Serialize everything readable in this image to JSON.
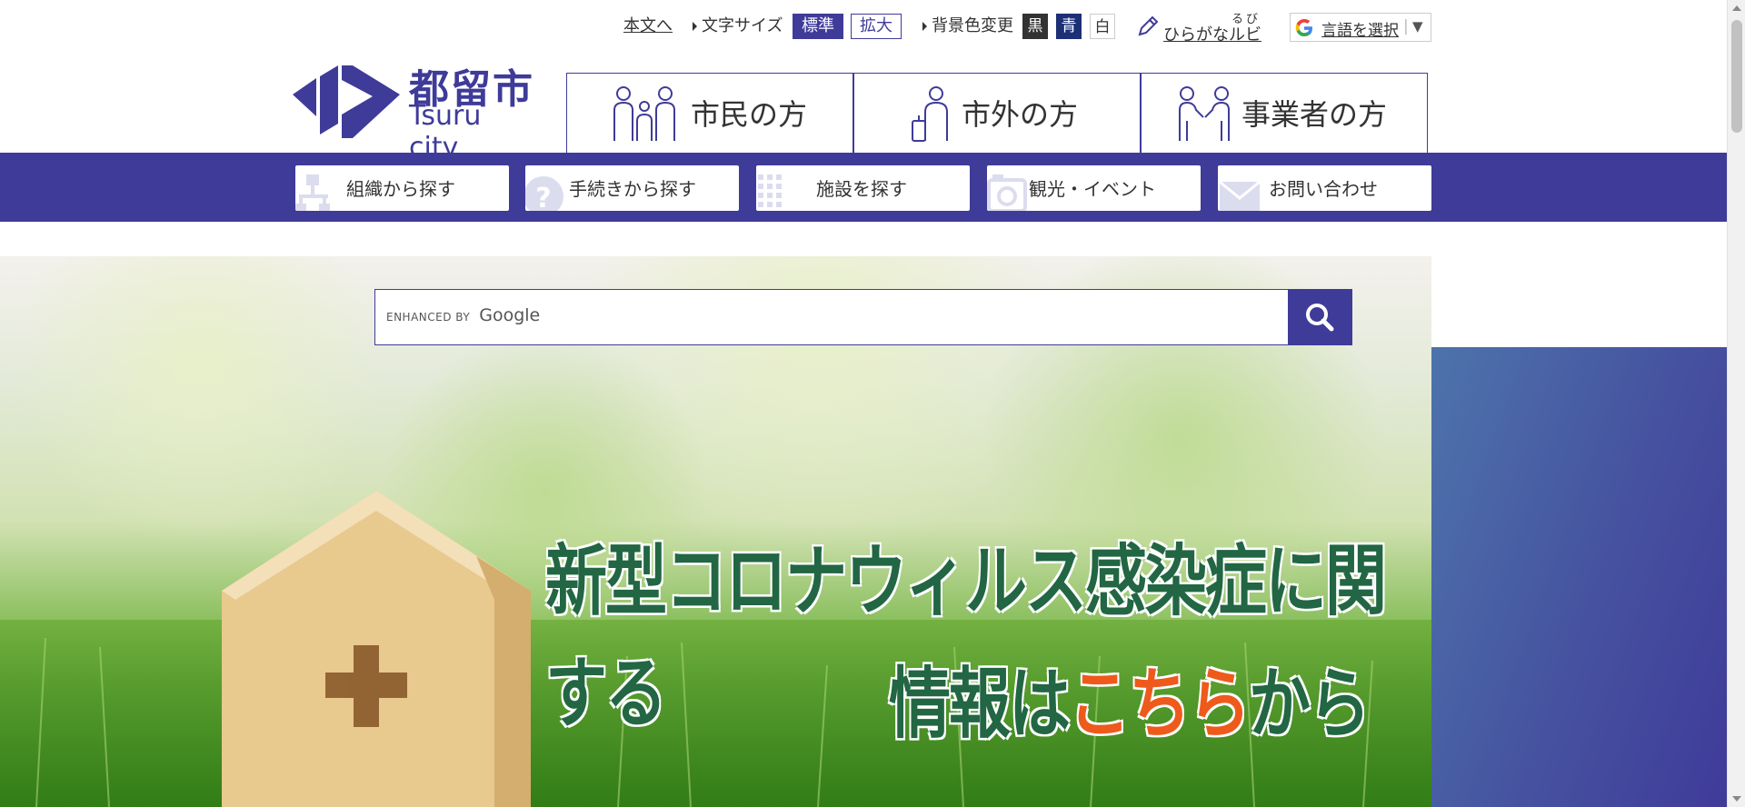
{
  "util": {
    "skip_link": "本文へ",
    "font_size_label": "文字サイズ",
    "font_standard": "標準",
    "font_large": "拡大",
    "bg_label": "背景色変更",
    "bg_black": "黒",
    "bg_blue": "青",
    "bg_white": "白",
    "ruby_reading": "るび",
    "ruby_label": "ひらがなルビ",
    "translate_label": "言語を選択",
    "translate_arrow": "▼"
  },
  "logo": {
    "jp": "都留市",
    "en": "Tsuru city"
  },
  "audience": [
    {
      "label": "市民の方",
      "icon": "family-icon"
    },
    {
      "label": "市外の方",
      "icon": "traveler-icon"
    },
    {
      "label": "事業者の方",
      "icon": "handshake-icon"
    }
  ],
  "categories": [
    {
      "label": "組織から探す",
      "icon": "org-chart-icon"
    },
    {
      "label": "手続きから探す",
      "icon": "question-icon"
    },
    {
      "label": "施設を探す",
      "icon": "building-icon"
    },
    {
      "label": "観光・イベント",
      "icon": "camera-icon"
    },
    {
      "label": "お問い合わせ",
      "icon": "mail-icon"
    }
  ],
  "search": {
    "enhanced_by": "ENHANCED BY",
    "provider": "Google"
  },
  "banner": {
    "line1": "新型コロナウィルス感染症に関する",
    "line2_a": "情報は",
    "line2_b": "こちら",
    "line2_c": "から"
  },
  "colors": {
    "brand": "#3f3b99",
    "banner_text": "#226644",
    "banner_highlight": "#ee5a1c"
  }
}
